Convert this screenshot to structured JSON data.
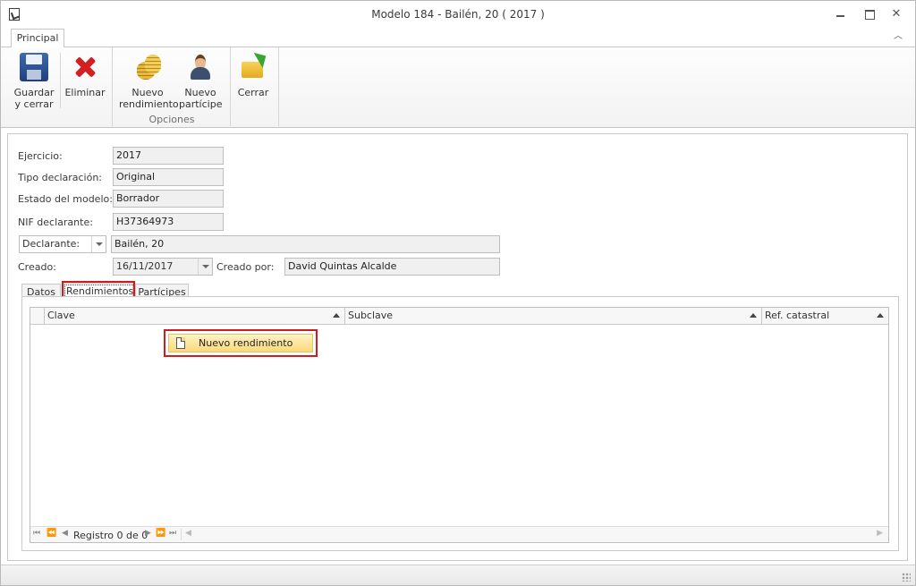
{
  "window": {
    "title": "Modelo 184 - Bailén, 20 ( 2017 )"
  },
  "ribbon": {
    "tab_label": "Principal",
    "buttons": {
      "save": "Guardar\ny cerrar",
      "delete": "Eliminar",
      "new_income": "Nuevo\nrendimiento",
      "new_participant": "Nuevo\npartícipe",
      "close": "Cerrar"
    },
    "group_label": "Opciones"
  },
  "form": {
    "ejercicio_label": "Ejercicio:",
    "ejercicio_value": "2017",
    "tipo_label": "Tipo declaración:",
    "tipo_value": "Original",
    "estado_label": "Estado del modelo:",
    "estado_value": "Borrador",
    "nif_label": "NIF declarante:",
    "nif_value": "H37364973",
    "declarante_combo": "Declarante:",
    "declarante_value": "Bailén, 20",
    "creado_label": "Creado:",
    "creado_value": "16/11/2017",
    "creado_por_label": "Creado por:",
    "creado_por_value": "David Quintas Alcalde"
  },
  "tabs": [
    "Datos",
    "Rendimientos",
    "Partícipes"
  ],
  "grid": {
    "columns": [
      "Clave",
      "Subclave",
      "Ref. catastral"
    ],
    "navigator": {
      "record_text": "Registro 0 de 0"
    }
  },
  "context_menu": {
    "item": "Nuevo rendimiento"
  },
  "colors": {
    "highlight": "#d01c1c",
    "menu_hover": "#fad97a"
  }
}
